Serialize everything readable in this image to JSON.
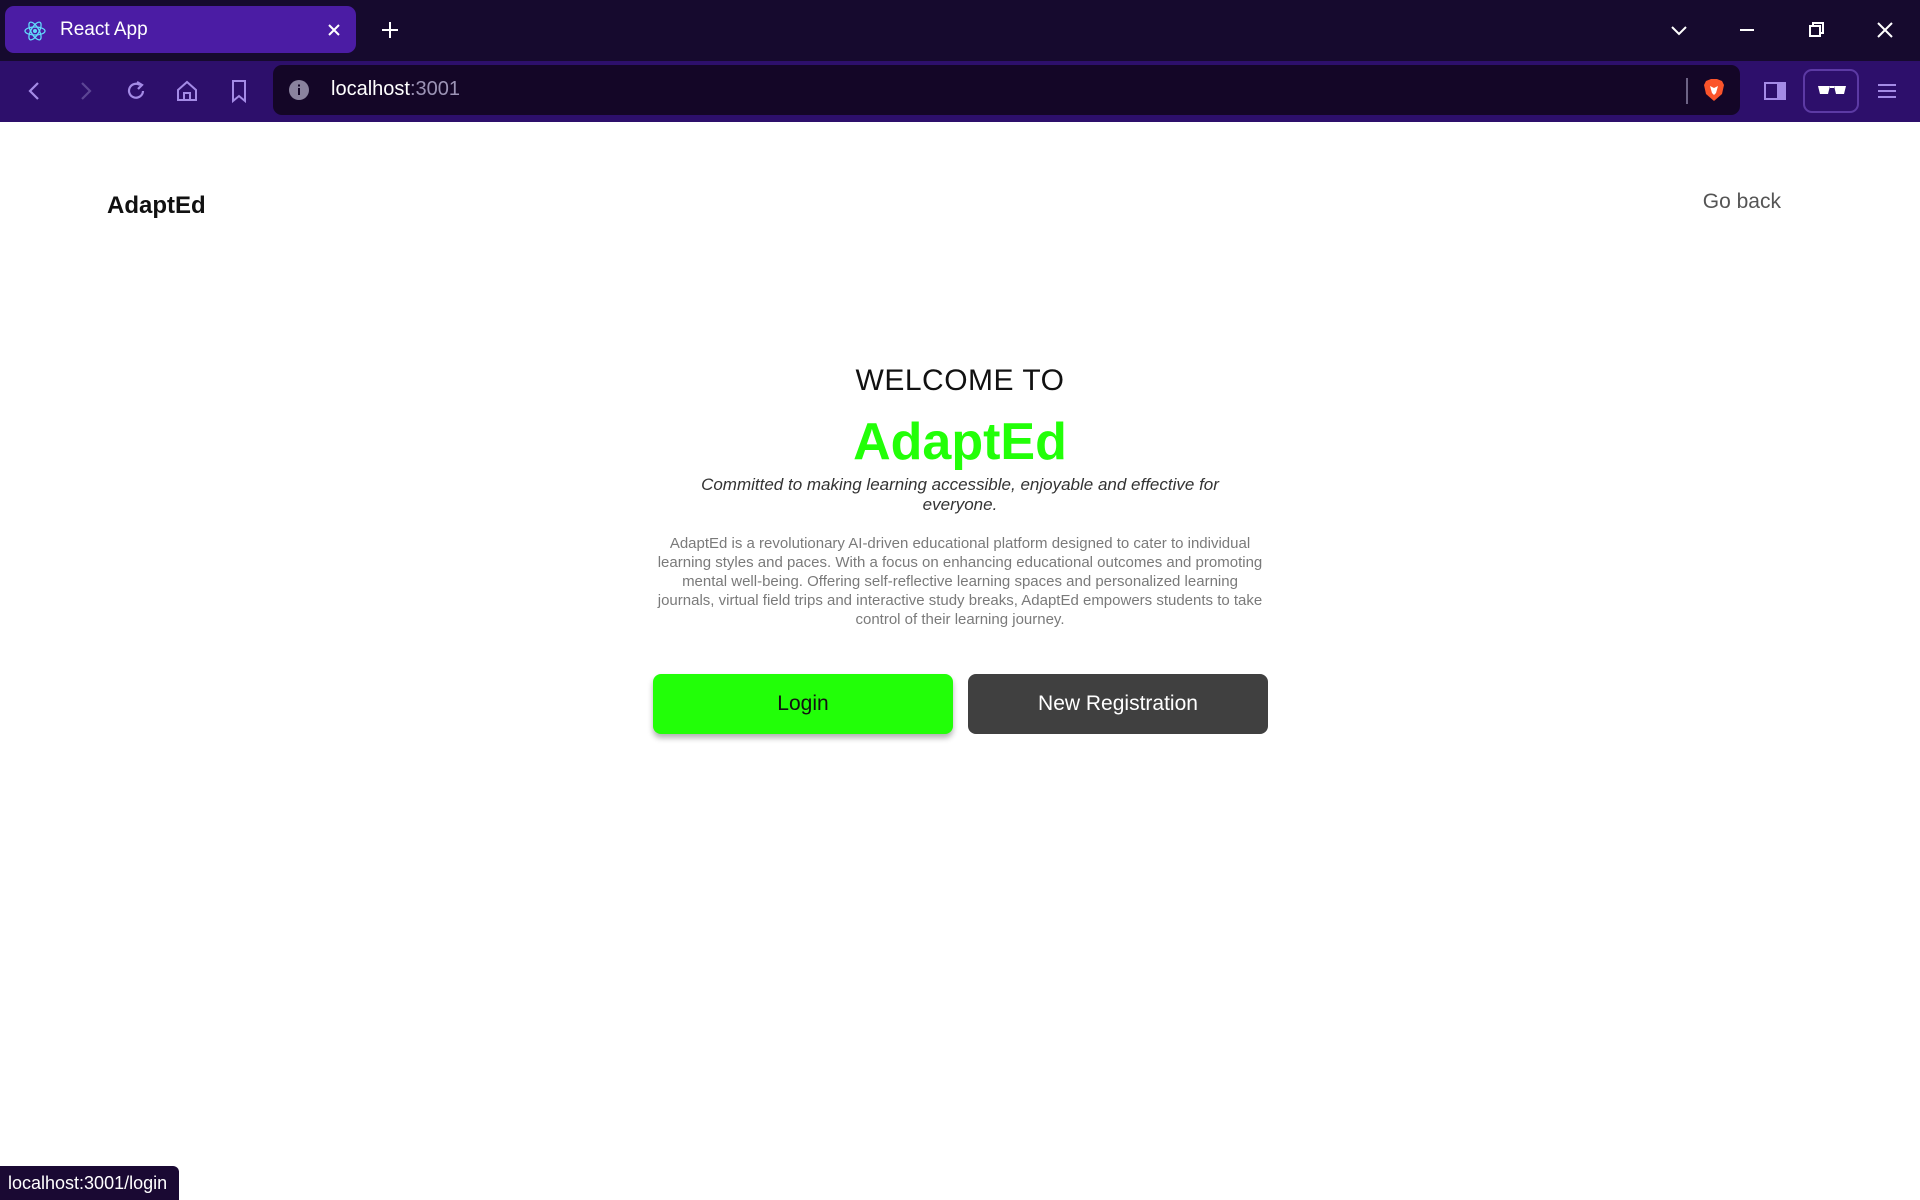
{
  "browser": {
    "tab_title": "React App",
    "url_host": "localhost",
    "url_port": ":3001",
    "icons": [
      "react-favicon-icon",
      "close-icon",
      "plus-icon",
      "chevron-down-icon",
      "minimize-icon",
      "restore-icon",
      "window-close-icon",
      "back-icon",
      "forward-icon",
      "reload-icon",
      "home-icon",
      "bookmark-icon",
      "info-icon",
      "brave-lion-icon",
      "sidebar-icon",
      "reader-glasses-icon",
      "menu-icon"
    ],
    "colors": {
      "tabbar": "#160a2e",
      "active_tab": "#4b1ca4",
      "toolbar": "#2d0f6b"
    }
  },
  "nav": {
    "brand": "AdaptEd",
    "go_back": "Go back"
  },
  "hero": {
    "welcome": "WELCOME TO",
    "title": "AdaptEd",
    "tagline": "Committed to making learning accessible, enjoyable and effective for everyone.",
    "description": "AdaptEd is a revolutionary AI-driven educational platform designed to cater to individual learning styles and paces. With a focus on enhancing educational outcomes and promoting mental well-being. Offering self-reflective learning spaces and personalized learning journals, virtual field trips and interactive study breaks, AdaptEd empowers students to take control of their learning journey."
  },
  "actions": {
    "login": "Login",
    "register": "New Registration"
  },
  "status": {
    "link_preview": "localhost:3001/login"
  },
  "colors": {
    "accent": "#22ff08",
    "secondary_button": "#404040"
  }
}
